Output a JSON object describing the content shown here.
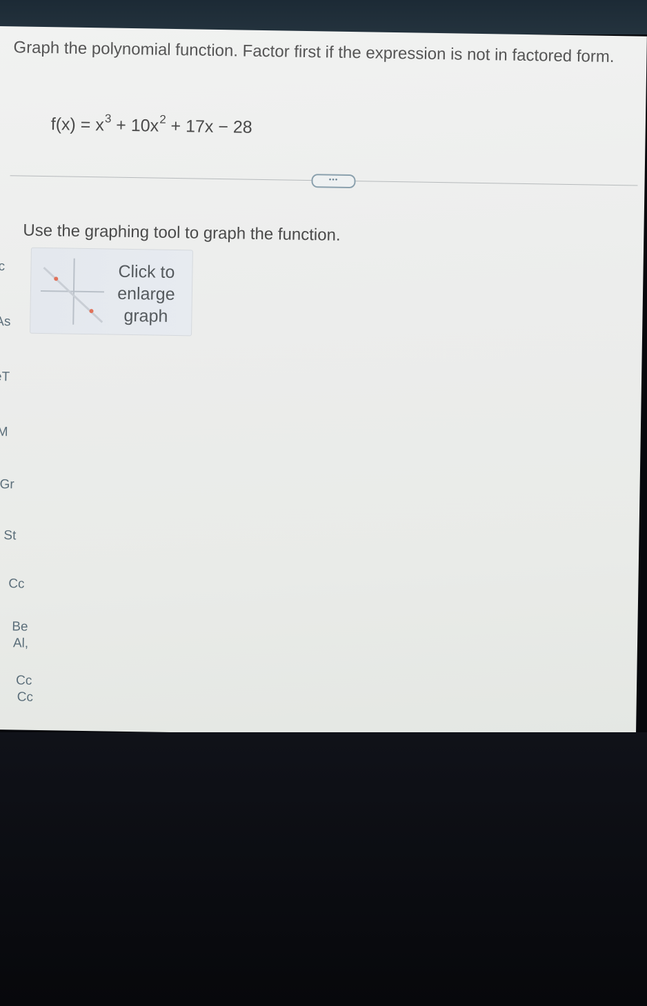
{
  "question": {
    "prompt": "Graph the polynomial function. Factor first if the expression is not in factored form."
  },
  "equation": {
    "lhs": "f(x) = x",
    "exp1": "3",
    "part2": " + 10x",
    "exp2": "2",
    "part3": " + 17x − 28"
  },
  "more_button": {
    "label": "•••"
  },
  "instruction": {
    "text": "Use the graphing tool to graph the function."
  },
  "graph_thumbnail": {
    "label_line1": "Click to",
    "label_line2": "enlarge",
    "label_line3": "graph",
    "accent_color": "#e0725a"
  },
  "sidebar_fragments": [
    {
      "text": "c"
    },
    {
      "text": "As"
    },
    {
      "text": "eT"
    },
    {
      "text": "M"
    },
    {
      "text": "Gr"
    },
    {
      "text": "St"
    },
    {
      "text": "Cc"
    },
    {
      "text": "Be"
    },
    {
      "text": "Al,"
    },
    {
      "text": "Cc"
    },
    {
      "text": "Cc"
    }
  ]
}
